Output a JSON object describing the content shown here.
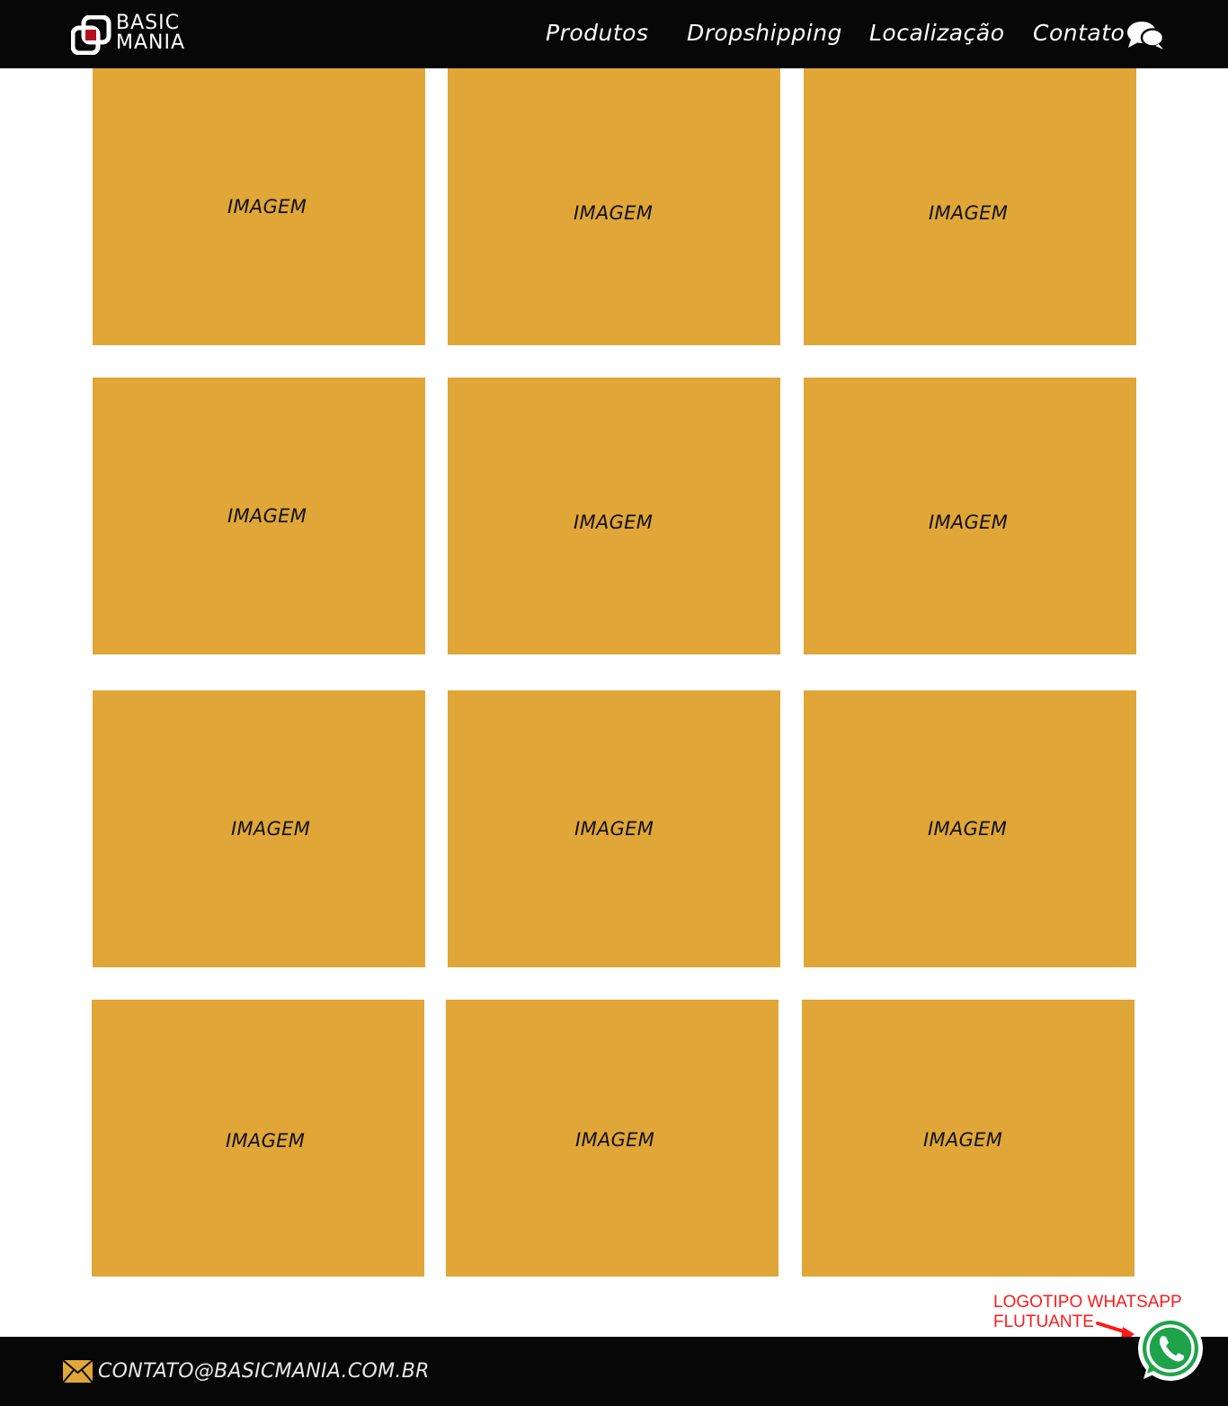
{
  "header": {
    "logo": {
      "line1": "BASIC",
      "line2": "MANIA"
    },
    "nav": [
      {
        "label": "Produtos"
      },
      {
        "label": "Dropshipping"
      },
      {
        "label": "Localização"
      },
      {
        "label": "Contato"
      }
    ]
  },
  "grid": {
    "placeholder_color": "#e0a637",
    "tiles": [
      {
        "label": "IMAGEM"
      },
      {
        "label": "IMAGEM"
      },
      {
        "label": "IMAGEM"
      },
      {
        "label": "IMAGEM"
      },
      {
        "label": "IMAGEM"
      },
      {
        "label": "IMAGEM"
      },
      {
        "label": "IMAGEM"
      },
      {
        "label": "IMAGEM"
      },
      {
        "label": "IMAGEM"
      },
      {
        "label": "IMAGEM"
      },
      {
        "label": "IMAGEM"
      },
      {
        "label": "IMAGEM"
      }
    ]
  },
  "footer": {
    "email": "CONTATO@BASICMANIA.COM.BR",
    "icon": "mail-icon"
  },
  "whatsapp": {
    "annotation_line1": "LOGOTIPO WHATSAPP",
    "annotation_line2": "FLUTUANTE",
    "icon": "whatsapp-icon",
    "brand_color": "#1fa34a",
    "annotation_color": "#ff1a1a"
  }
}
